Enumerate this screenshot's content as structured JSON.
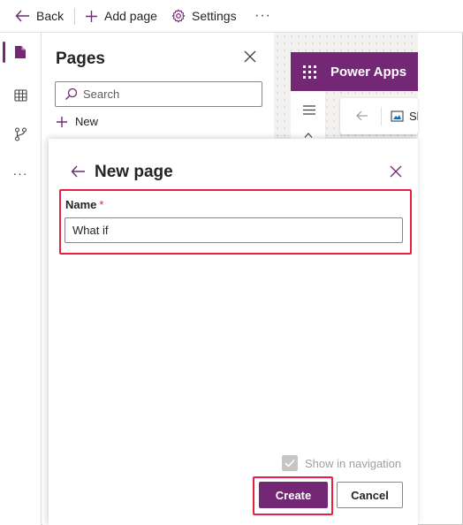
{
  "command_bar": {
    "back_label": "Back",
    "add_page_label": "Add page",
    "settings_label": "Settings",
    "more_label": "···"
  },
  "left_rail": {
    "items": [
      {
        "icon": "page-icon",
        "active": true
      },
      {
        "icon": "table-icon",
        "active": false
      },
      {
        "icon": "flow-icon",
        "active": false
      },
      {
        "icon": "more-icon",
        "label": "···",
        "active": false
      }
    ]
  },
  "pages_panel": {
    "title": "Pages",
    "search_placeholder": "Search",
    "new_label": "New"
  },
  "app_preview": {
    "title": "Power Apps",
    "screen_label": "Sl"
  },
  "dialog": {
    "title": "New page",
    "name_label": "Name",
    "required_marker": "*",
    "name_value": "What if",
    "show_in_navigation_label": "Show in navigation",
    "show_in_navigation_checked": true,
    "create_label": "Create",
    "cancel_label": "Cancel"
  },
  "colors": {
    "brand": "#742774",
    "highlight": "#e81f3f",
    "required": "#c4314b"
  }
}
